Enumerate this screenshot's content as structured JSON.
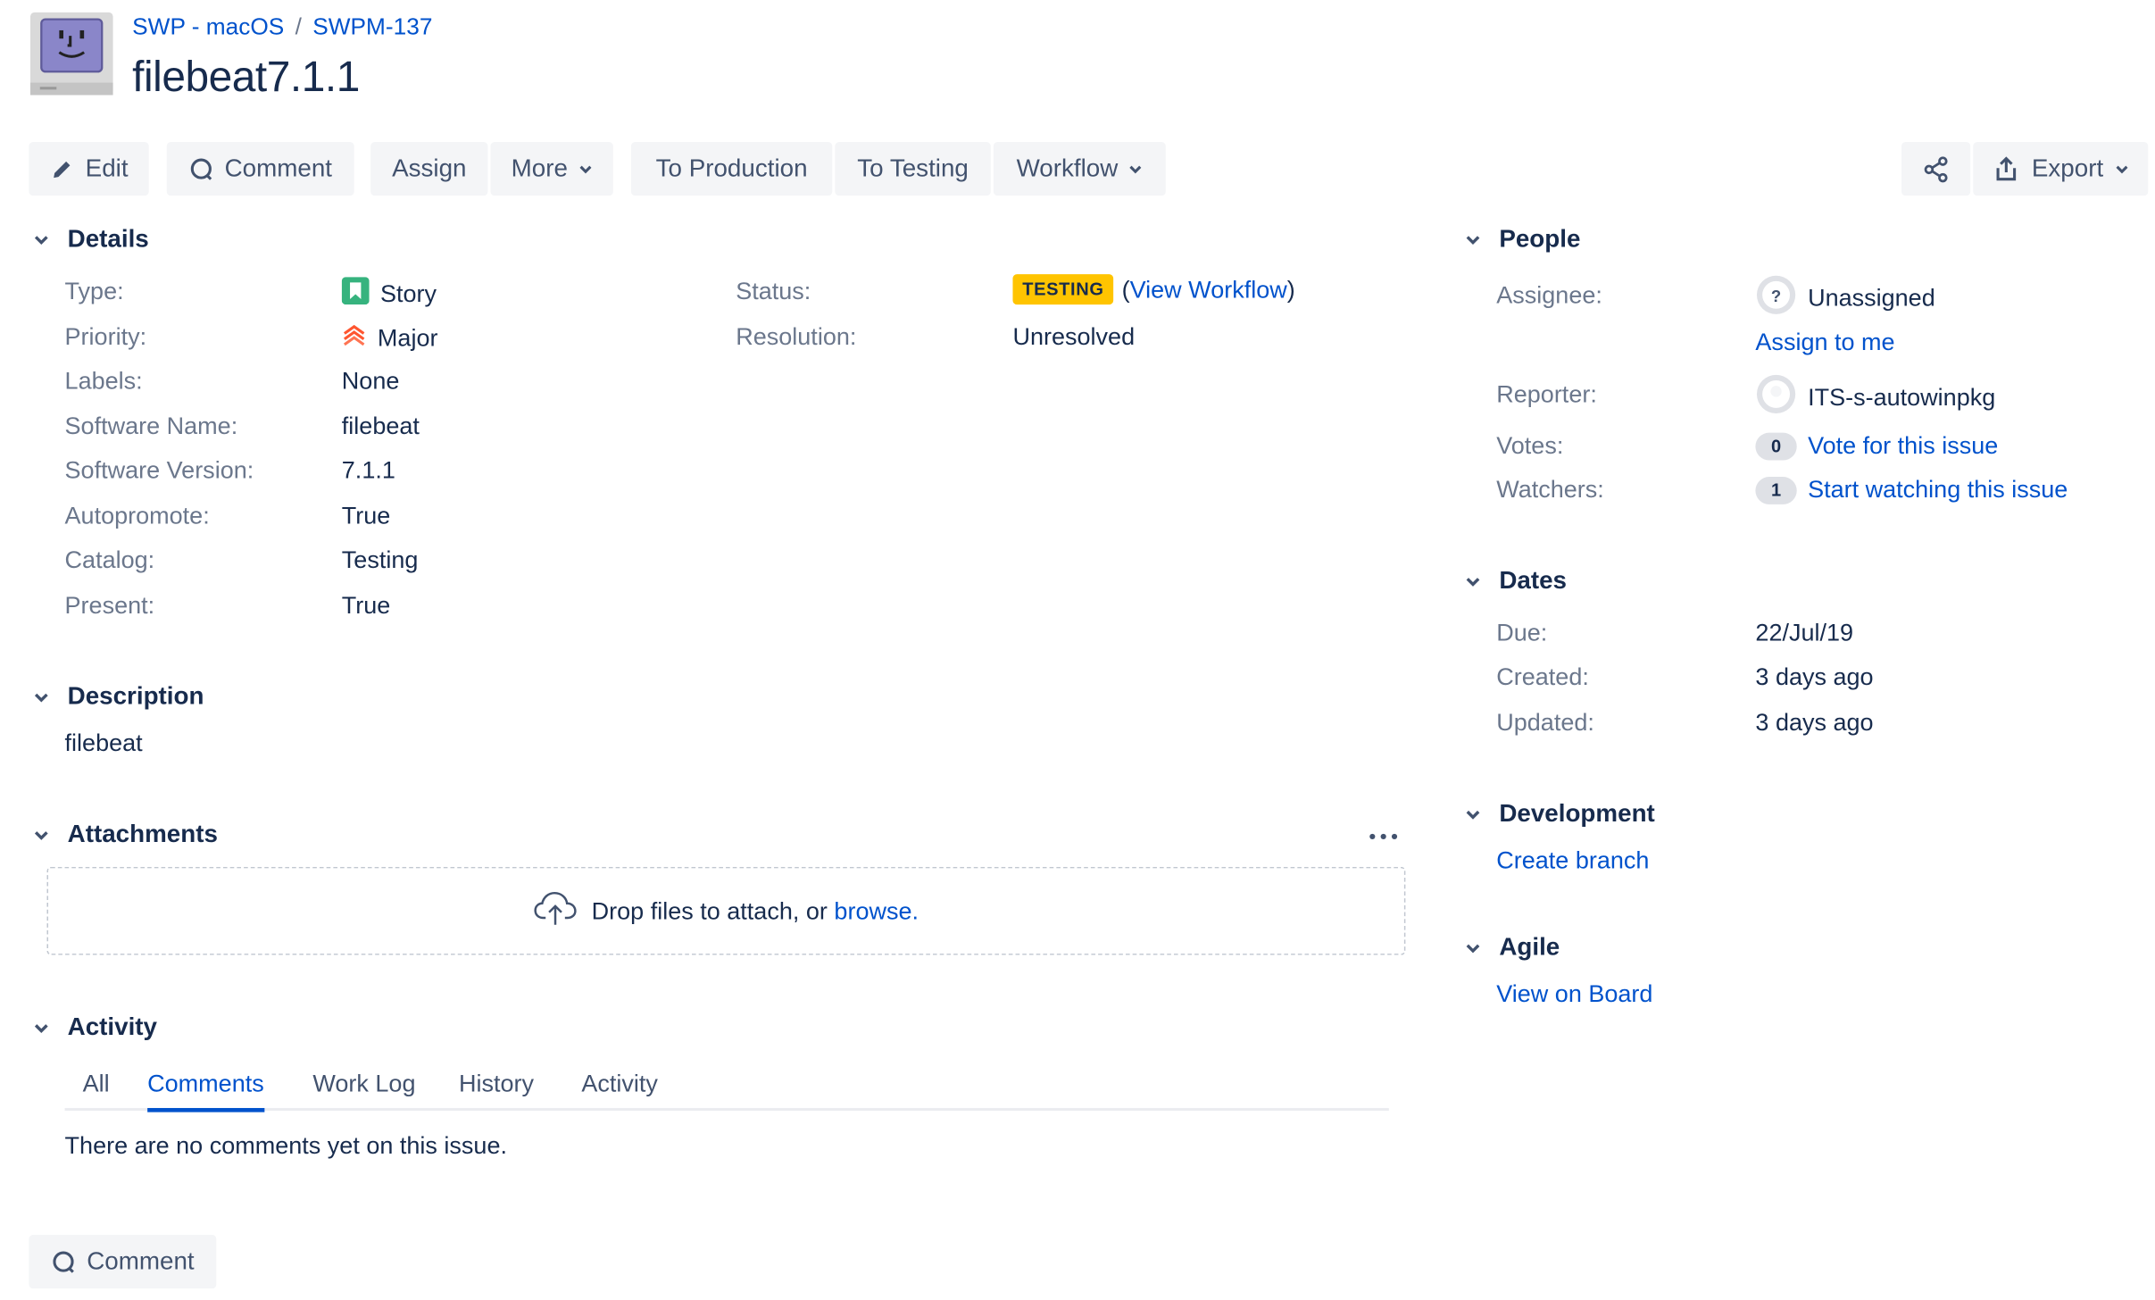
{
  "breadcrumb": {
    "project": "SWP - macOS",
    "separator": "/",
    "issue_key": "SWPM-137"
  },
  "issue": {
    "title": "filebeat7.1.1"
  },
  "toolbar": {
    "edit": "Edit",
    "comment": "Comment",
    "assign": "Assign",
    "more": "More",
    "to_production": "To Production",
    "to_testing": "To Testing",
    "workflow": "Workflow",
    "export": "Export"
  },
  "details": {
    "heading": "Details",
    "fields": [
      {
        "label": "Type:",
        "value": "Story",
        "icon": "story-icon"
      },
      {
        "label": "Priority:",
        "value": "Major",
        "icon": "priority-major-icon"
      },
      {
        "label": "Labels:",
        "value": "None"
      },
      {
        "label": "Software Name:",
        "value": "filebeat"
      },
      {
        "label": "Software Version:",
        "value": "7.1.1"
      },
      {
        "label": "Autopromote:",
        "value": "True"
      },
      {
        "label": "Catalog:",
        "value": "Testing"
      },
      {
        "label": "Present:",
        "value": "True"
      }
    ],
    "status_label": "Status:",
    "status_value": "TESTING",
    "view_workflow": "View Workflow",
    "resolution_label": "Resolution:",
    "resolution_value": "Unresolved"
  },
  "description": {
    "heading": "Description",
    "text": "filebeat"
  },
  "attachments": {
    "heading": "Attachments",
    "drop_text": "Drop files to attach, or",
    "browse": "browse."
  },
  "activity": {
    "heading": "Activity",
    "tabs": [
      "All",
      "Comments",
      "Work Log",
      "History",
      "Activity"
    ],
    "active_tab": "Comments",
    "empty_text": "There are no comments yet on this issue.",
    "comment_button": "Comment"
  },
  "people": {
    "heading": "People",
    "assignee_label": "Assignee:",
    "assignee_value": "Unassigned",
    "assign_to_me": "Assign to me",
    "reporter_label": "Reporter:",
    "reporter_value": "ITS-s-autowinpkg",
    "votes_label": "Votes:",
    "votes_count": "0",
    "vote_link": "Vote for this issue",
    "watchers_label": "Watchers:",
    "watchers_count": "1",
    "watch_link": "Start watching this issue"
  },
  "dates": {
    "heading": "Dates",
    "due_label": "Due:",
    "due_value": "22/Jul/19",
    "created_label": "Created:",
    "created_value": "3 days ago",
    "updated_label": "Updated:",
    "updated_value": "3 days ago"
  },
  "development": {
    "heading": "Development",
    "create_branch": "Create branch"
  },
  "agile": {
    "heading": "Agile",
    "view_on_board": "View on Board"
  },
  "colors": {
    "link": "#0052cc",
    "status_lozenge": "#ffc400",
    "button_bg": "#f4f5f7",
    "text": "#172b4d",
    "label": "#6b778c"
  }
}
